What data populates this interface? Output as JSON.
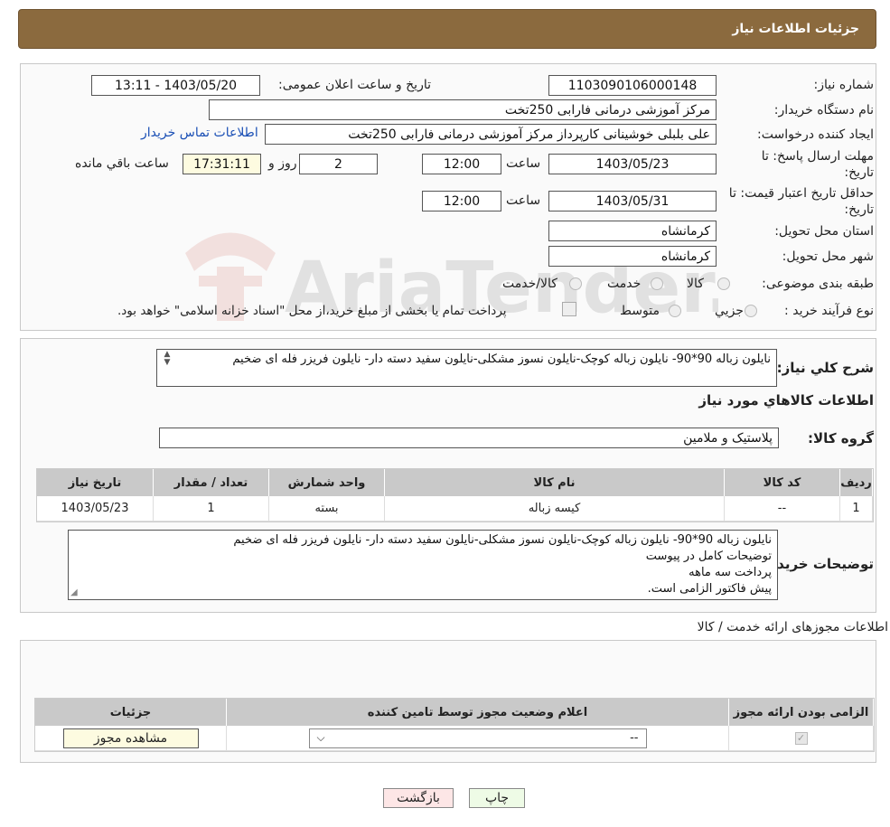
{
  "header": {
    "title": "جزئیات اطلاعات نیاز"
  },
  "fields": {
    "need_number_label": "شماره نیاز:",
    "need_number": "1103090106000148",
    "announce_label": "تاریخ و ساعت اعلان عمومی:",
    "announce_value": "1403/05/20 - 13:11",
    "buyer_org_label": "نام دستگاه خریدار:",
    "buyer_org": "مرکز آموزشی  درمانی فارابی 250تخت",
    "requester_label": "ایجاد کننده درخواست:",
    "requester": "علی بلبلی خوشینانی کارپرداز مرکز آموزشی  درمانی فارابی 250تخت",
    "buyer_contact_link": "اطلاعات تماس خریدار",
    "deadline_label_1": "مهلت ارسال پاسخ: تا",
    "deadline_label_2": "تاریخ:",
    "deadline_date": "1403/05/23",
    "time_label": "ساعت",
    "deadline_time": "12:00",
    "days_value": "2",
    "days_label": "روز و",
    "remaining_time": "17:31:11",
    "remaining_label": "ساعت باقي مانده",
    "validity_label_1": "حداقل تاریخ اعتبار قیمت: تا",
    "validity_label_2": "تاریخ:",
    "validity_date": "1403/05/31",
    "validity_time": "12:00",
    "province_label": "استان محل تحویل:",
    "province": "کرمانشاه",
    "city_label": "شهر محل تحویل:",
    "city": "کرمانشاه",
    "category_label": "طبقه بندی موضوعی:",
    "category_options": [
      "کالا",
      "خدمت",
      "کالا/خدمت"
    ],
    "purchase_type_label": "نوع فرآیند خرید :",
    "purchase_options": [
      "جزيي",
      "متوسط"
    ],
    "purchase_note": "پرداخت تمام یا بخشی از مبلغ خرید،از محل \"اسناد خزانه اسلامی\" خواهد بود."
  },
  "summary": {
    "label": "شرح کلي نياز:",
    "text": "نایلون زباله 90*90- نایلون زباله کوچک-نایلون نسوز مشکلی-نایلون سفید دسته دار- نایلون فریزر فله ای ضخیم",
    "goods_info_title": "اطلاعات کالاهاي مورد نياز",
    "goods_group_label": "گروه کالا:",
    "goods_group": "پلاستیک و ملامین"
  },
  "goods_table": {
    "headers": [
      "رديف",
      "کد کالا",
      "نام کالا",
      "واحد شمارش",
      "تعداد / مقدار",
      "تاريخ نياز"
    ],
    "rows": [
      [
        "1",
        "--",
        "کیسه زباله",
        "بسته",
        "1",
        "1403/05/23"
      ]
    ]
  },
  "buyer_notes": {
    "label": "توضيحات خريدار:",
    "lines": [
      "نایلون زباله 90*90- نایلون زباله کوچک-نایلون نسوز مشکلی-نایلون سفید دسته دار- نایلون فریزر فله ای ضخیم",
      "توضیحات کامل در پیوست",
      "پرداخت سه ماهه",
      "پیش فاکتور الزامی است."
    ]
  },
  "permits": {
    "title": "اطلاعات مجوزهای ارائه خدمت / کالا",
    "headers": [
      "الزامی بودن ارائه مجوز",
      "اعلام وضعیت مجوز توسط تامین کننده",
      "جزئيات"
    ],
    "select_value": "--",
    "view_button": "مشاهده مجوز"
  },
  "buttons": {
    "print": "چاپ",
    "back": "بازگشت"
  },
  "watermark": {
    "text": "AriaTender.neT"
  }
}
